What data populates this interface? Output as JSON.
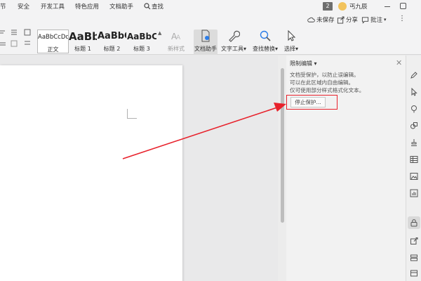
{
  "menu_tabs": [
    "节",
    "安全",
    "开发工具",
    "特色应用",
    "文档助手"
  ],
  "search_label": "查找",
  "window": {
    "page_badge": "2",
    "user_name": "丐九辰"
  },
  "ribbon_right": {
    "save": "未保存",
    "share": "分享",
    "comment": "批注"
  },
  "styles": [
    {
      "preview": "AaBbCcDd",
      "label": "正文"
    },
    {
      "preview": "AaBb",
      "label": "标题 1"
    },
    {
      "preview": "AaBbC",
      "label": "标题 2"
    },
    {
      "preview": "AaBbC",
      "label": "标题 3"
    }
  ],
  "ribbon_buttons": {
    "new_style": "新样式",
    "doc_assistant": "文档助手",
    "text_tools": "文字工具",
    "find_replace": "查找替换",
    "select": "选择"
  },
  "panel": {
    "title": "限制编辑",
    "lines": [
      "文档受保护，以防止误编辑。",
      "可以在此区域内自由编辑。",
      "仅可使用部分样式格式化文本。"
    ],
    "stop_button": "停止保护..."
  },
  "colors": {
    "highlight": "#e8212b",
    "accent": "#2b7de9"
  }
}
